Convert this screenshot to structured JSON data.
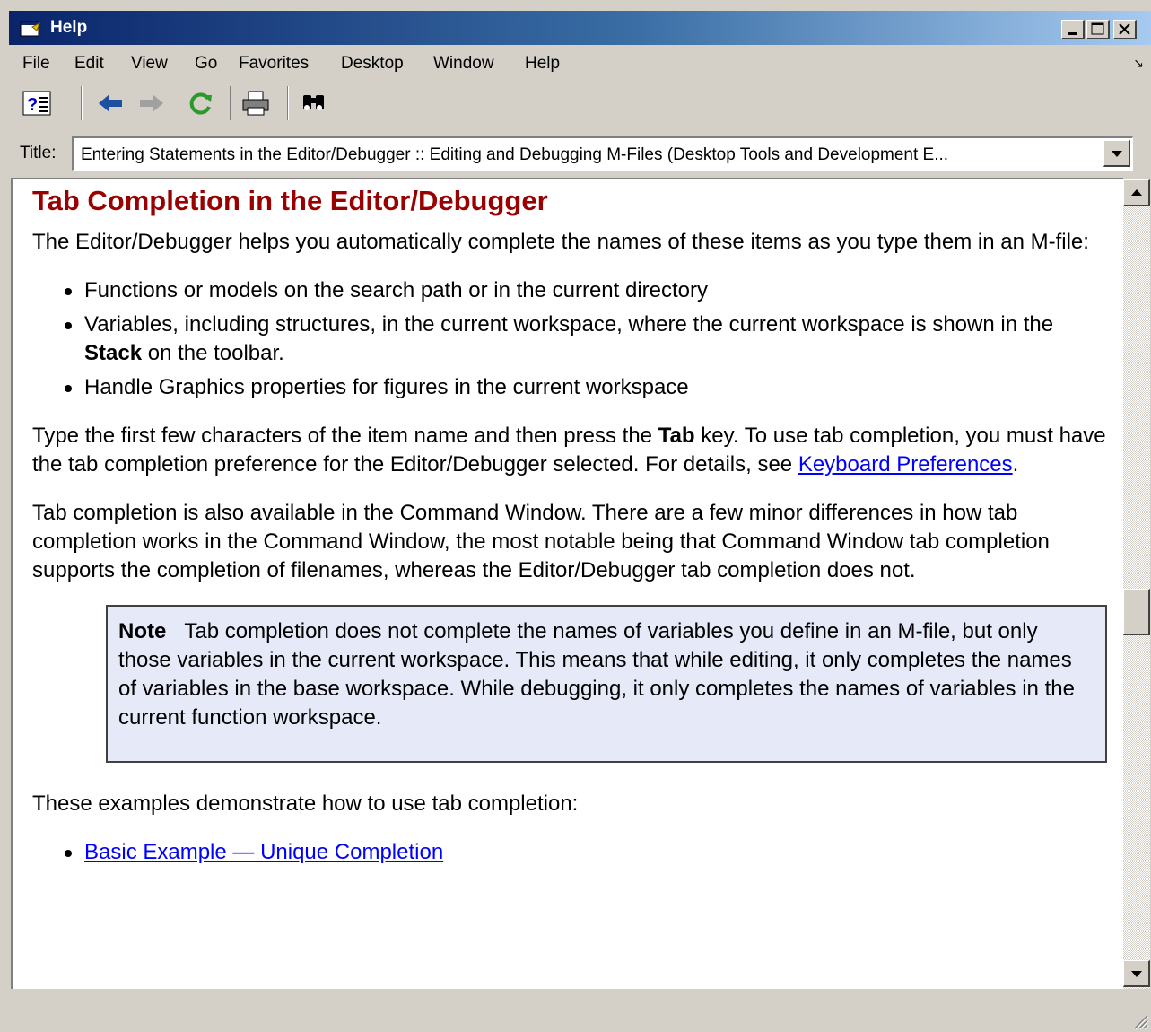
{
  "window": {
    "title": "Help"
  },
  "menu": {
    "items": [
      "File",
      "Edit",
      "View",
      "Go",
      "Favorites",
      "Desktop",
      "Window",
      "Help"
    ]
  },
  "toolbar": {
    "buttons": [
      "help-contents-icon",
      "back-arrow-icon",
      "forward-arrow-icon",
      "refresh-icon",
      "print-icon",
      "find-binoculars-icon"
    ]
  },
  "title_row": {
    "label": "Title:",
    "value": "Entering Statements in the Editor/Debugger :: Editing and Debugging M-Files (Desktop Tools and Development E..."
  },
  "doc": {
    "heading": "Tab Completion in the Editor/Debugger",
    "intro": "The Editor/Debugger helps you automatically complete the names of these items as you type them in an M-file:",
    "items": [
      "Functions or models on the search path or in the current directory",
      {
        "before": "Variables, including structures, in the current workspace, where the current workspace is shown in the ",
        "bold": "Stack",
        "after": " on the toolbar."
      },
      "Handle Graphics properties for figures in the current workspace"
    ],
    "para2": {
      "before": "Type the first few characters of the item name and then press the ",
      "bold": "Tab",
      "after": " key. To use tab completion, you must have the tab completion preference for the Editor/Debugger selected. For details, see ",
      "link": "Keyboard Preferences",
      "end": "."
    },
    "para3": "Tab completion is also available in the Command Window. There are a few minor differences in how tab completion works in the Command Window, the most notable being that Command Window tab completion supports the completion of filenames, whereas the Editor/Debugger tab completion does not.",
    "note": {
      "label": "Note",
      "text": "Tab completion does not complete the names of variables you define in an M-file, but only those variables in the current workspace. This means that while editing, it only completes the names of variables in the base workspace. While debugging, it only completes the names of variables in the current function workspace."
    },
    "para4": "These examples demonstrate how to use tab completion:",
    "examples": [
      "Basic Example — Unique Completion"
    ]
  },
  "colors": {
    "heading": "#990000",
    "link": "#0000ff",
    "note_bg": "#e6e9f8",
    "chrome": "#d4d0c8"
  }
}
